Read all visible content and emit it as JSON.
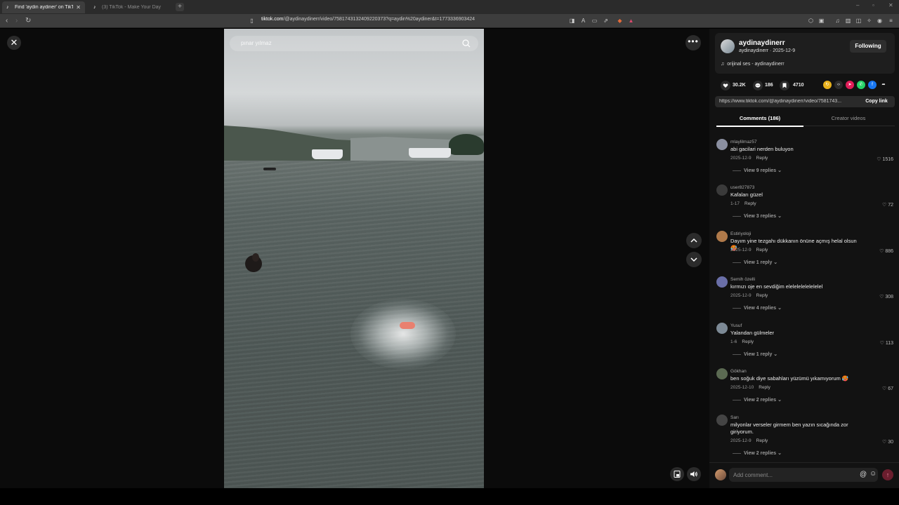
{
  "browser": {
    "tabs": [
      {
        "title": "Find 'aydin aydiner' on TikTok",
        "active": true
      },
      {
        "title": "(3) TikTok - Make Your Day",
        "active": false
      }
    ],
    "new_tab": "+",
    "url_host": "tiktok.com",
    "url_path": "/@aydinaydinerr/video/7581743132409220373?q=aydin%20aydiner&t=1773336903424",
    "window_controls": [
      "–",
      "▫",
      "✕"
    ]
  },
  "video": {
    "search_placeholder": "pınar yılmaz"
  },
  "author": {
    "display_name": "aydinaydinerr",
    "handle_date": "aydinaydinerr · 2025-12-9",
    "follow_label": "Following",
    "sound": "orijinal ses - aydinaydinerr"
  },
  "stats": {
    "likes": "30.2K",
    "comments": "186",
    "saves": "4710"
  },
  "share": {
    "link": "https://www.tiktok.com/@aydinaydinerr/video/7581743...",
    "copy_label": "Copy link"
  },
  "tabs": {
    "comments": "Comments (186)",
    "creator": "Creator videos"
  },
  "comments": [
    {
      "user": "mlaylilmaz57",
      "text": "abi gacilari nerden buluyon",
      "date": "2025-12-9",
      "reply": "Reply",
      "likes": "1516",
      "views": "View 9 replies",
      "avatar_color": "#8a8fa0"
    },
    {
      "user": "user827873",
      "text": "Kafaları güzel",
      "date": "1-17",
      "reply": "Reply",
      "likes": "72",
      "views": "View 3 replies",
      "avatar_color": "#3a3a3a"
    },
    {
      "user": "Estiriyoloji",
      "text": "Dayım yine tezgahı dükkanın önüne açmış helal olsun 🥵",
      "date": "2025-12-9",
      "reply": "Reply",
      "likes": "886",
      "views": "View 1 reply",
      "avatar_color": "#b07a4a"
    },
    {
      "user": "Semih özelli",
      "text": "kırmızı oje en sevdiğim elelelelelelelelel",
      "date": "2025-12-9",
      "reply": "Reply",
      "likes": "308",
      "views": "View 4 replies",
      "avatar_color": "#6a6fa8"
    },
    {
      "user": "Yusuf",
      "text": "Yalandan gülmeler",
      "date": "1-6",
      "reply": "Reply",
      "likes": "113",
      "views": "View 1 reply",
      "avatar_color": "#7d8a96"
    },
    {
      "user": "Gökhan",
      "text": "ben soğuk diye sabahları yüzümü yıkamıyorum 🥵",
      "date": "2025-12-10",
      "reply": "Reply",
      "likes": "67",
      "views": "View 2 replies",
      "avatar_color": "#5b6a52"
    },
    {
      "user": "Sarı",
      "text": "milyonlar verseler girmem ben yazın sıcağında zor giriyorum.",
      "date": "2025-12-9",
      "reply": "Reply",
      "likes": "30",
      "views": "View 2 replies",
      "avatar_color": "#444444"
    }
  ],
  "comment_input": {
    "placeholder": "Add comment...",
    "at": "@",
    "emoji": "☺",
    "send": "↑"
  },
  "colors": {
    "panel_bg": "#121212",
    "page_bg": "#0b0b0b",
    "send_accent": "#6b1e2e"
  }
}
